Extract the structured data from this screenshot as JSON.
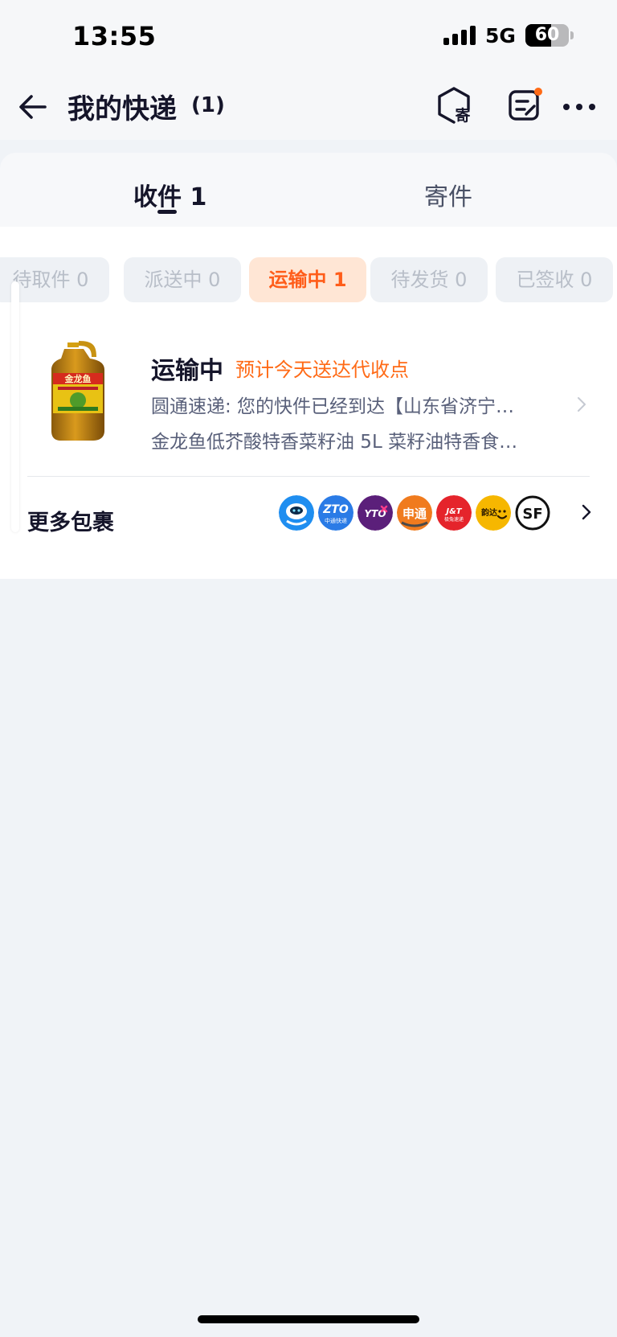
{
  "status_bar": {
    "time": "13:55",
    "network": "5G",
    "battery": "60",
    "battery_level": 0.6
  },
  "header": {
    "title": "我的快递",
    "count": "(1)",
    "send_badge": "寄"
  },
  "tabs": [
    {
      "label": "收件 1",
      "active": true
    },
    {
      "label": "寄件",
      "active": false
    }
  ],
  "filters": [
    {
      "label": "待取件 0",
      "active": false
    },
    {
      "label": "派送中 0",
      "active": false
    },
    {
      "label": "运输中 1",
      "active": true
    },
    {
      "label": "待发货 0",
      "active": false
    },
    {
      "label": "已签收 0",
      "active": false
    }
  ],
  "package": {
    "status": "运输中",
    "eta": "预计今天送达代收点",
    "tracking": "圆通速递: 您的快件已经到达【山东省济宁…",
    "product": "金龙鱼低芥酸特香菜籽油 5L 菜籽油特香食…",
    "product_brand": "金龙鱼"
  },
  "more_packages": {
    "label": "更多包裹",
    "carriers": [
      {
        "name": "cainiao",
        "text": "",
        "color": "#1f8ef0"
      },
      {
        "name": "zto",
        "text": "ZTO",
        "subtext": "中通快递",
        "color": "#2a7be6"
      },
      {
        "name": "yto",
        "text": "YTO",
        "color": "#5b1f7a"
      },
      {
        "name": "sto",
        "text": "申通",
        "color": "#f07b1e"
      },
      {
        "name": "jt",
        "text": "J&T",
        "subtext": "极兔速递",
        "color": "#e5242b"
      },
      {
        "name": "yunda",
        "text": "韵达",
        "color": "#f6b700"
      },
      {
        "name": "sf",
        "text": "SF",
        "color": "#ffffff"
      }
    ]
  },
  "colors": {
    "accent": "#ff6a16",
    "active_chip_bg": "#ffe6d5",
    "text_primary": "#15152a",
    "text_secondary": "#59607a"
  }
}
